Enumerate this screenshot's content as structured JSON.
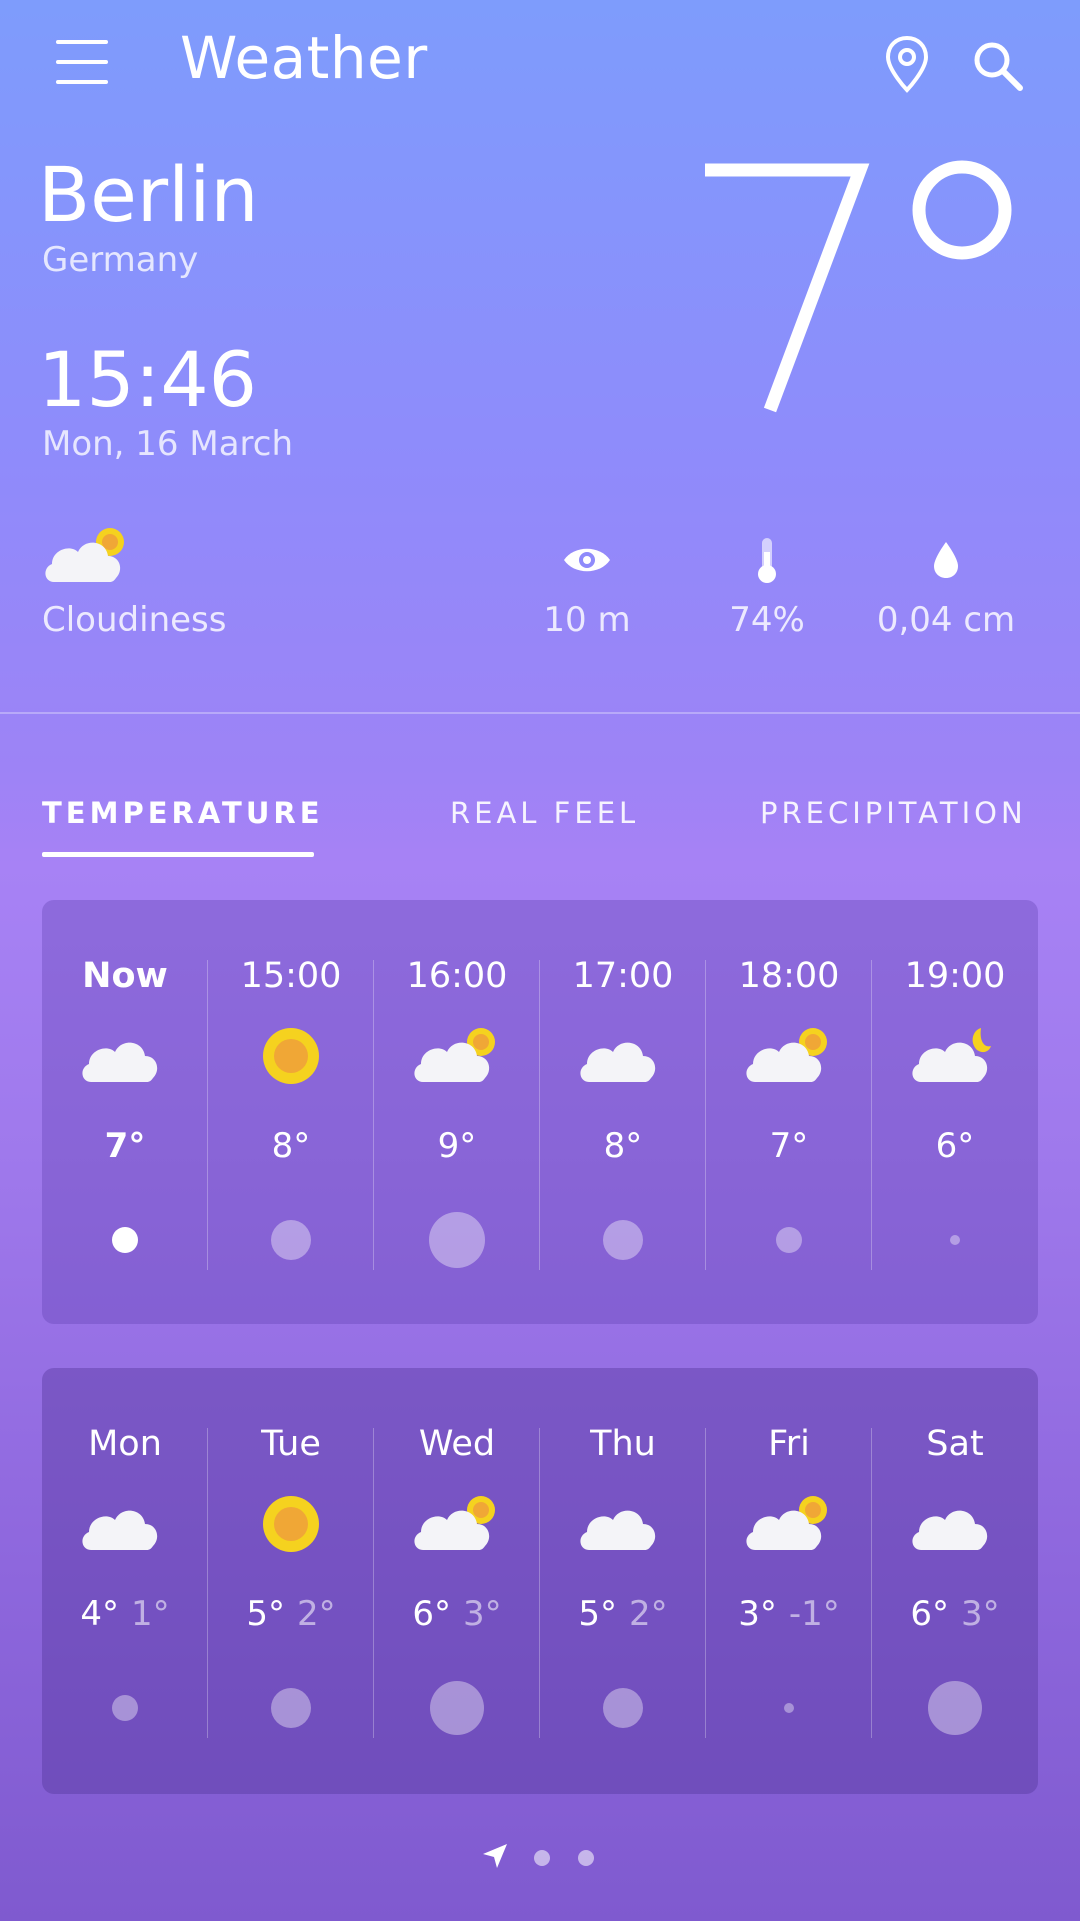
{
  "header": {
    "title": "Weather",
    "menu_icon": "hamburger-menu-icon",
    "location_icon": "map-pin-icon",
    "search_icon": "search-icon"
  },
  "current": {
    "city": "Berlin",
    "country": "Germany",
    "time": "15:46",
    "date": "Mon, 16 March",
    "temperature": "7°",
    "condition": "Cloudiness",
    "condition_icon": "partly-cloudy-icon",
    "stats": [
      {
        "icon": "eye-icon",
        "value": "10 m"
      },
      {
        "icon": "thermometer-icon",
        "value": "74%"
      },
      {
        "icon": "droplet-icon",
        "value": "0,04 cm"
      }
    ]
  },
  "tabs": [
    {
      "label": "TEMPERATURE",
      "active": true
    },
    {
      "label": "REAL FEEL",
      "active": false
    },
    {
      "label": "PRECIPITATION",
      "active": false
    }
  ],
  "hourly": [
    {
      "label": "Now",
      "icon": "cloud-icon",
      "temp": "7°",
      "dot_size": "small",
      "current": true
    },
    {
      "label": "15:00",
      "icon": "sun-icon",
      "temp": "8°",
      "dot_size": "medium"
    },
    {
      "label": "16:00",
      "icon": "partly-cloudy-icon",
      "temp": "9°",
      "dot_size": "large"
    },
    {
      "label": "17:00",
      "icon": "cloud-icon",
      "temp": "8°",
      "dot_size": "medium"
    },
    {
      "label": "18:00",
      "icon": "partly-cloudy-icon",
      "temp": "7°",
      "dot_size": "small"
    },
    {
      "label": "19:00",
      "icon": "cloud-moon-icon",
      "temp": "6°",
      "dot_size": "tiny"
    }
  ],
  "daily": [
    {
      "day": "Mon",
      "icon": "cloud-icon",
      "high": "4°",
      "low": "1°",
      "dot_size": "small"
    },
    {
      "day": "Tue",
      "icon": "sun-icon",
      "high": "5°",
      "low": "2°",
      "dot_size": "medium"
    },
    {
      "day": "Wed",
      "icon": "partly-cloudy-icon",
      "high": "6°",
      "low": "3°",
      "dot_size": "large"
    },
    {
      "day": "Thu",
      "icon": "cloud-icon",
      "high": "5°",
      "low": "2°",
      "dot_size": "medium"
    },
    {
      "day": "Fri",
      "icon": "partly-cloudy-icon",
      "high": "3°",
      "low": "-1°",
      "dot_size": "tiny"
    },
    {
      "day": "Sat",
      "icon": "cloud-icon",
      "high": "6°",
      "low": "3°",
      "dot_size": "large"
    }
  ],
  "pager": {
    "nav_icon": "navigation-arrow-icon",
    "pages": 3,
    "active_page": 0
  },
  "colors": {
    "sun": "#f5d21f",
    "sun_core": "#f0a736",
    "cloud": "#f4f4f8"
  }
}
